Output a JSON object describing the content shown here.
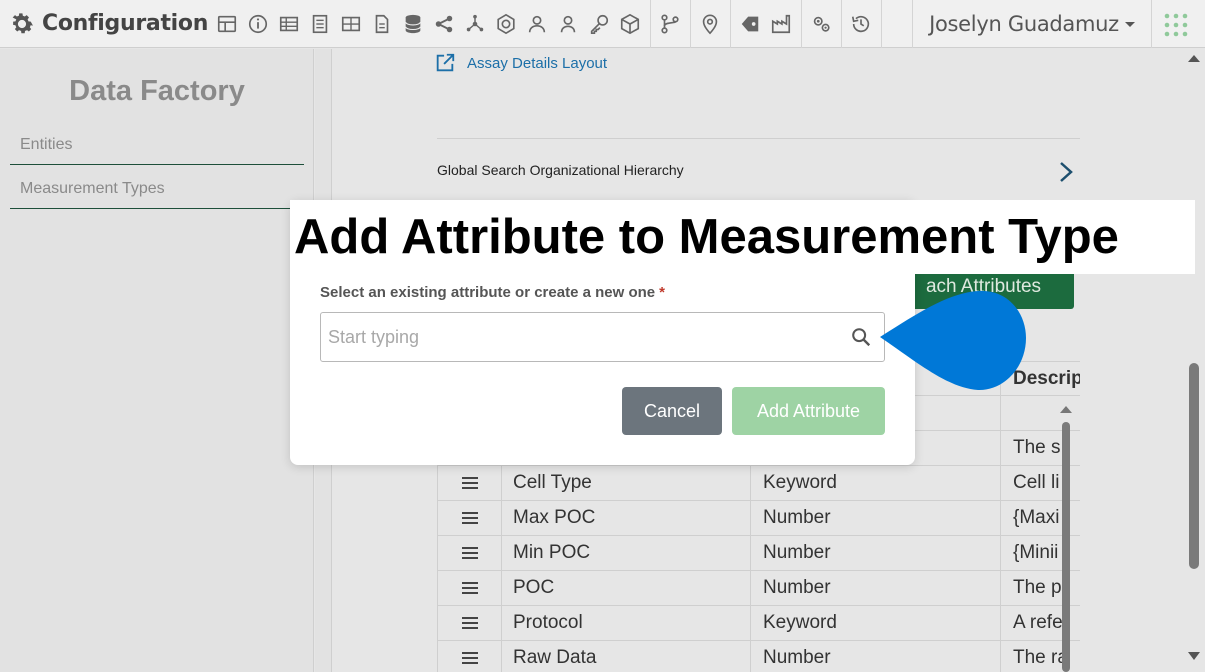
{
  "topbar": {
    "title": "Configuration",
    "user_name": "Joselyn Guadamuz",
    "icons": [
      "gear-icon",
      "layout-icon",
      "info-icon",
      "table-icon",
      "document-icon",
      "grid-icon",
      "file-icon",
      "database-icon",
      "share-icon",
      "network-icon",
      "hexagon-icon",
      "users-icon",
      "user-icon",
      "key-icon",
      "cube-icon",
      "workflow-icon",
      "location-pin-icon",
      "tag-icon",
      "factory-icon",
      "settings-gears-icon",
      "history-icon",
      "apps-grid-icon"
    ]
  },
  "sidebar": {
    "title": "Data Factory",
    "items": [
      {
        "label": "Entities"
      },
      {
        "label": "Measurement Types"
      }
    ]
  },
  "main": {
    "layout_link": "Assay Details Layout",
    "hierarchy_label": "Global Search Organizational Hierarchy",
    "attach_button": "ach Attributes",
    "table": {
      "header_description": "Descrip",
      "rows": [
        {
          "name": "",
          "type": "",
          "description": "The s"
        },
        {
          "name": "Cell Type",
          "type": "Keyword",
          "description": "Cell li"
        },
        {
          "name": "Max POC",
          "type": "Number",
          "description": "{Maxi"
        },
        {
          "name": "Min POC",
          "type": "Number",
          "description": "{Minii"
        },
        {
          "name": "POC",
          "type": "Number",
          "description": "The p"
        },
        {
          "name": "Protocol",
          "type": "Keyword",
          "description": "A refe"
        },
        {
          "name": "Raw Data",
          "type": "Number",
          "description": "The ra"
        }
      ]
    }
  },
  "modal": {
    "title": "Add Attribute to Measurement Type",
    "field_label": "Select an existing attribute or create a new one",
    "required_mark": "*",
    "input_placeholder": "Start typing",
    "input_value": "",
    "cancel_label": "Cancel",
    "add_label": "Add Attribute"
  },
  "colors": {
    "attach_button": "#1c6b3e",
    "link": "#1c6fa8",
    "cancel_button": "#6c757d",
    "add_button_disabled": "#9ed3a4",
    "pointer": "#0078d7"
  }
}
